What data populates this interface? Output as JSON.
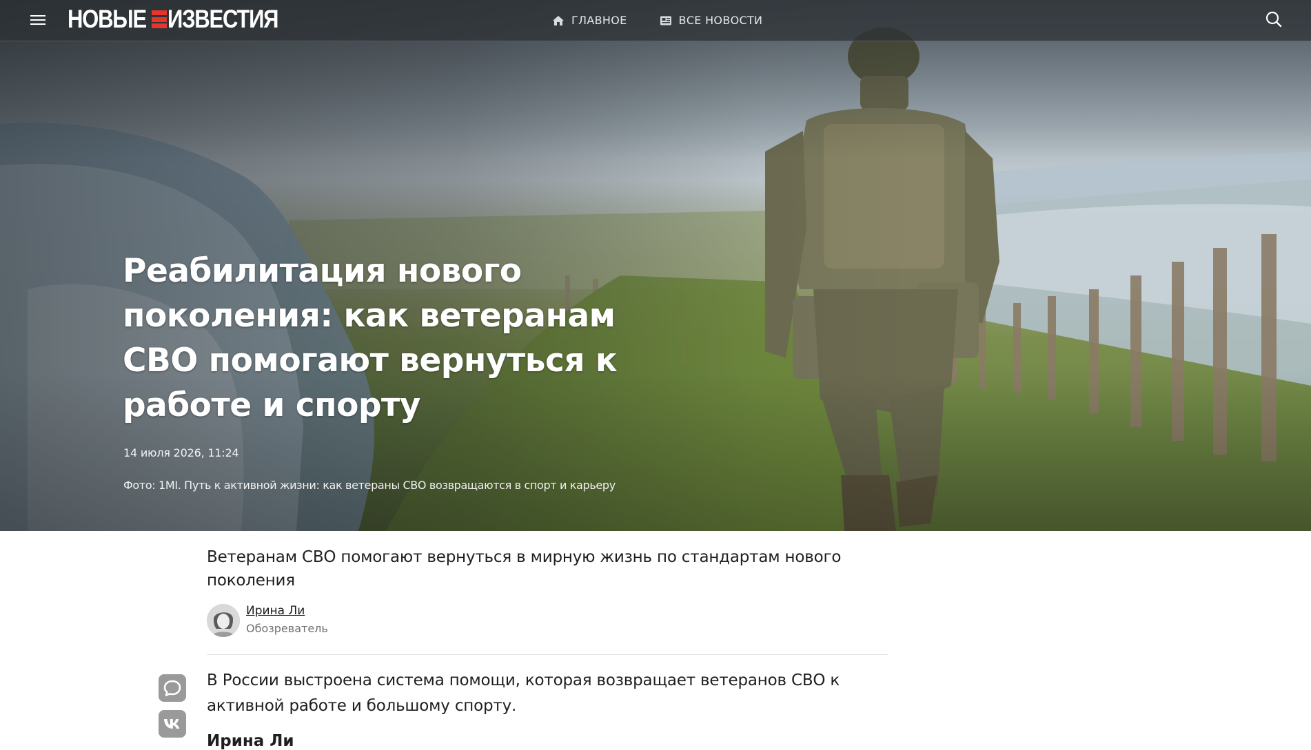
{
  "header": {
    "logo_left": "НОВЫЕ",
    "logo_right": "ИЗВЕСТИЯ",
    "nav": [
      {
        "label": "ГЛАВНОЕ",
        "icon": "home-icon"
      },
      {
        "label": "ВСЕ НОВОСТИ",
        "icon": "newspaper-icon"
      }
    ],
    "menu_icon": "hamburger-menu-icon",
    "search_icon": "search-icon"
  },
  "hero": {
    "title": "Реабилитация нового поколения: как ветеранам СВО помогают вернуться к работе и спорту",
    "date": "14 июля 2026, 11:24",
    "photo_caption": "Фото: 1MI. Путь к активной жизни: как ветераны СВО возвращаются в спорт и карьеру"
  },
  "article": {
    "lead": "Ветеранам СВО помогают вернуться в мирную жизнь по стандартам нового поколения",
    "author": {
      "name": "Ирина Ли",
      "role": "Обозреватель"
    },
    "share": [
      {
        "name": "comment-icon"
      },
      {
        "name": "vk-icon"
      }
    ],
    "first_paragraph": "В России выстроена система помощи, которая возвращает ветеранов СВО к активной работе и большому спорту.",
    "byline_partial": "Ирина Ли"
  },
  "colors": {
    "accent": "#e8342b",
    "topbar": "#2c3034",
    "text": "#1f1f1f",
    "muted": "#6f6f6f",
    "share_bg": "#9a9a9a"
  }
}
